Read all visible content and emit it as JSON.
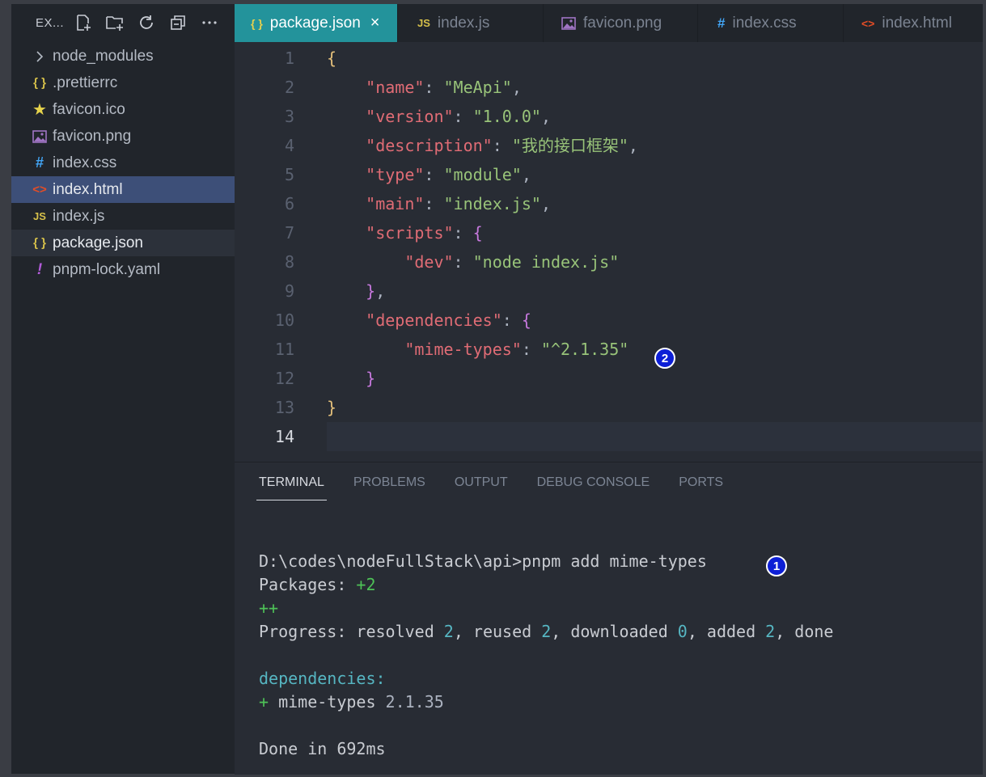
{
  "explorer": {
    "title": "EX...",
    "items": [
      {
        "label": "node_modules",
        "icon": "chevron-right-icon"
      },
      {
        "label": ".prettierrc",
        "icon": "json-braces-icon"
      },
      {
        "label": "favicon.ico",
        "icon": "star-icon"
      },
      {
        "label": "favicon.png",
        "icon": "image-icon"
      },
      {
        "label": "index.css",
        "icon": "hash-icon"
      },
      {
        "label": "index.html",
        "icon": "html-brackets-icon"
      },
      {
        "label": "index.js",
        "icon": "js-icon"
      },
      {
        "label": "package.json",
        "icon": "json-braces-icon"
      },
      {
        "label": "pnpm-lock.yaml",
        "icon": "exclamation-icon"
      }
    ],
    "selected_index": 5,
    "active_index": 7
  },
  "tabs": [
    {
      "label": "package.json",
      "icon": "json-braces-icon",
      "active": true,
      "close": "×"
    },
    {
      "label": "index.js",
      "icon": "js-icon"
    },
    {
      "label": "favicon.png",
      "icon": "image-icon"
    },
    {
      "label": "index.css",
      "icon": "hash-icon"
    },
    {
      "label": "index.html",
      "icon": "html-brackets-icon"
    }
  ],
  "icons": {
    "json": "{ }",
    "js": "JS",
    "hash": "#",
    "html": "<>",
    "star": "★",
    "excl": "!",
    "chevron": ">"
  },
  "editor": {
    "line_numbers": [
      "1",
      "2",
      "3",
      "4",
      "5",
      "6",
      "7",
      "8",
      "9",
      "10",
      "11",
      "12",
      "13",
      "14"
    ],
    "current_line": 14,
    "lines": [
      {
        "open_brace": "{"
      },
      {
        "key": "\"name\"",
        "value": "\"MeApi\"",
        "trail": ","
      },
      {
        "key": "\"version\"",
        "value": "\"1.0.0\"",
        "trail": ","
      },
      {
        "key": "\"description\"",
        "value": "\"我的接口框架\"",
        "trail": ","
      },
      {
        "key": "\"type\"",
        "value": "\"module\"",
        "trail": ","
      },
      {
        "key": "\"main\"",
        "value": "\"index.js\"",
        "trail": ","
      },
      {
        "key": "\"scripts\"",
        "brace": "{"
      },
      {
        "key": "\"dev\"",
        "value": "\"node index.js\""
      },
      {
        "close_brace": "}",
        "trail": ","
      },
      {
        "key": "\"dependencies\"",
        "brace": "{"
      },
      {
        "key": "\"mime-types\"",
        "value": "\"^2.1.35\""
      },
      {
        "close_brace": "}"
      },
      {
        "close_brace": "}"
      },
      {}
    ]
  },
  "badges": {
    "first": "1",
    "second": "2"
  },
  "panel": {
    "tabs": [
      "TERMINAL",
      "PROBLEMS",
      "OUTPUT",
      "DEBUG CONSOLE",
      "PORTS"
    ],
    "active_tab": 0
  },
  "terminal": {
    "prompt": "D:\\codes\\nodeFullStack\\api>pnpm add mime-types",
    "packages_label": "Packages: ",
    "packages_count": "+2",
    "plus_line": "++",
    "progress_prefix": "Progress: resolved ",
    "resolved": "2",
    "reused_label": ", reused ",
    "reused": "2",
    "downloaded_label": ", downloaded ",
    "downloaded": "0",
    "added_label": ", added ",
    "added": "2",
    "done_label": ", done",
    "deps_header": "dependencies:",
    "dep_plus": "+",
    "dep_name": " mime-types ",
    "dep_version": "2.1.35",
    "done_line": "Done in 692ms"
  }
}
